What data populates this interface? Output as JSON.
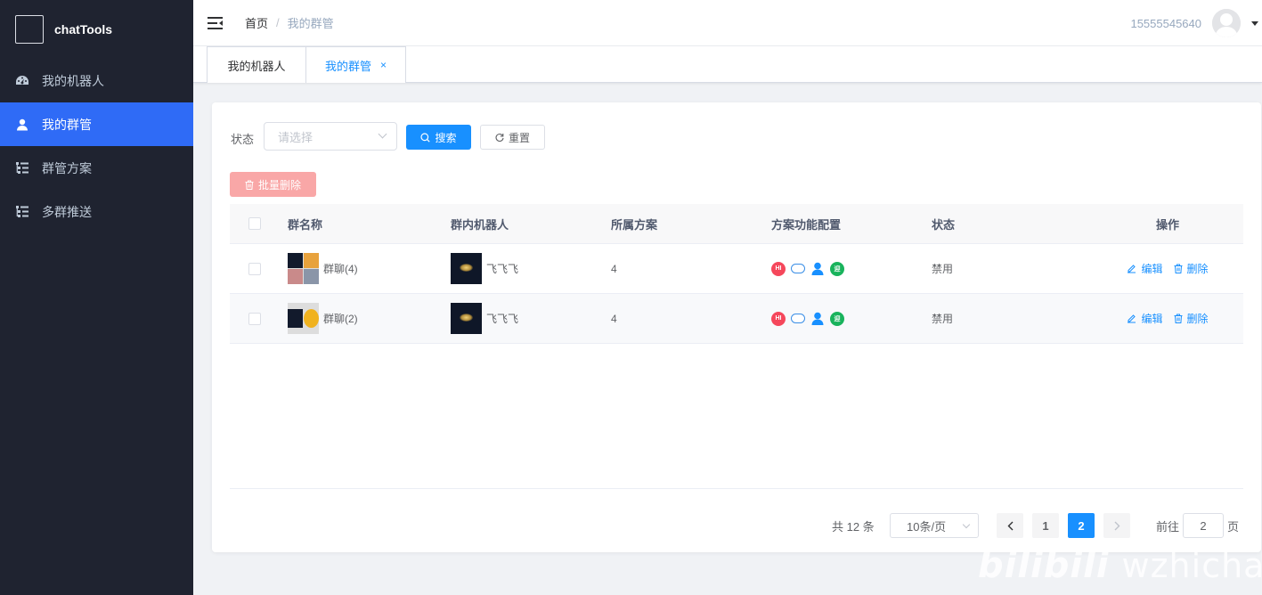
{
  "brand": {
    "name": "chatTools"
  },
  "sidebar": {
    "items": [
      {
        "label": "我的机器人",
        "icon": "dashboard-icon",
        "active": false
      },
      {
        "label": "我的群管",
        "icon": "user-icon",
        "active": true
      },
      {
        "label": "群管方案",
        "icon": "list-icon",
        "active": false
      },
      {
        "label": "多群推送",
        "icon": "list-icon",
        "active": false
      }
    ]
  },
  "header": {
    "breadcrumb": {
      "home": "首页",
      "separator": "/",
      "current": "我的群管"
    },
    "user_phone": "15555545640"
  },
  "tabs": [
    {
      "label": "我的机器人",
      "active": false
    },
    {
      "label": "我的群管",
      "active": true,
      "close": "×"
    }
  ],
  "filter": {
    "status_label": "状态",
    "status_placeholder": "请选择",
    "search_label": "搜索",
    "reset_label": "重置"
  },
  "batch_delete_label": "批量删除",
  "table": {
    "columns": [
      "群名称",
      "群内机器人",
      "所属方案",
      "方案功能配置",
      "状态",
      "操作"
    ],
    "rows": [
      {
        "group_name": "群聊(4)",
        "robot_name": "飞飞飞",
        "plan": "4",
        "status": "禁用",
        "edit": "编辑",
        "delete": "删除"
      },
      {
        "group_name": "群聊(2)",
        "robot_name": "飞飞飞",
        "plan": "4",
        "status": "禁用",
        "edit": "编辑",
        "delete": "删除"
      }
    ],
    "function_icons": [
      {
        "name": "hi-icon",
        "color": "#f5475b",
        "text": "HI"
      },
      {
        "name": "robot-icon",
        "color": "#3a8ee6"
      },
      {
        "name": "member-icon",
        "color": "#1890ff"
      },
      {
        "name": "welcome-icon",
        "color": "#19b35c",
        "text": "迎"
      }
    ]
  },
  "pagination": {
    "total": "共 12 条",
    "page_size": "10条/页",
    "pages": [
      "1",
      "2"
    ],
    "current_page": "2",
    "goto_prefix": "前往",
    "goto_value": "2",
    "goto_suffix": "页"
  },
  "watermark": {
    "logo": "bilibili",
    "text": "wzhichao"
  },
  "colors": {
    "primary": "#1890ff",
    "sidebar_bg": "#1f2330",
    "sidebar_active": "#2f6bf6",
    "danger_light": "#f9a7a7"
  }
}
